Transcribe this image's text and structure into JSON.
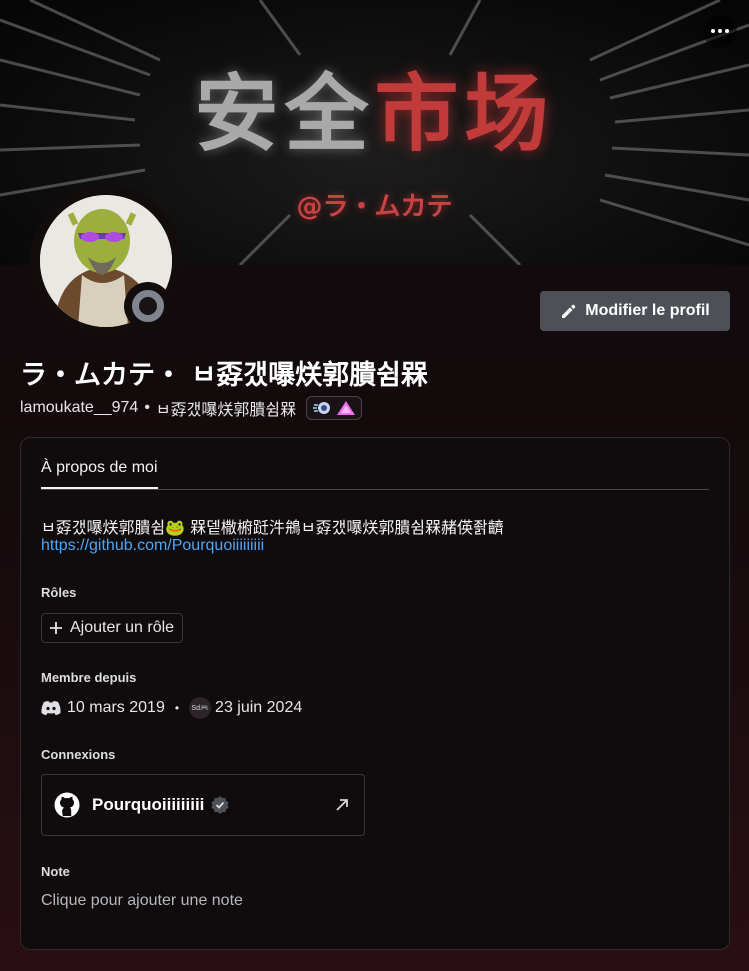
{
  "banner": {
    "title_white": "安全",
    "title_red": "市场",
    "handle": "@ラ・ムカテ"
  },
  "header": {
    "more_icon": "more-horizontal-icon",
    "edit_profile_label": "Modifier le profil",
    "edit_icon": "pencil-icon"
  },
  "profile": {
    "display_name": "ラ・ムカテ・ ㅂ孬갰嚗烪郭膭쉼槑",
    "username": "lamoukate__974",
    "separator": "•",
    "pronouns": "ㅂ孬갰嚗烪郭膭쉼槑",
    "status": "offline",
    "badges": [
      "hypesquad-balance-icon",
      "nitro-triangle-icon"
    ]
  },
  "about": {
    "tab_label": "À propos de moi",
    "bio": "ㅂ孬갰嚗烪郭膭쉼🐸 槑뎉橵󠀡椨跹汼鴘ㅂ孬갰嚗烪郭膭쉼槑󠀡赭偀좕䶩󠀡",
    "link": "https://github.com/Pourquoiiiiiiiii",
    "roles_title": "Rôles",
    "add_role_label": "Ajouter un rôle",
    "member_since_title": "Membre depuis",
    "discord_date": "10 mars 2019",
    "server_icon_text": "Sd🎮",
    "server_date": "23 juin 2024",
    "connections_title": "Connexions",
    "connection_name": "Pourquoiiiiiiiii",
    "connection_icon": "github-icon",
    "note_title": "Note",
    "note_placeholder": "Clique pour ajouter une note"
  },
  "colors": {
    "link": "#4ea6f5",
    "banner_red": "#c23b3b",
    "button": "#4e5058"
  }
}
